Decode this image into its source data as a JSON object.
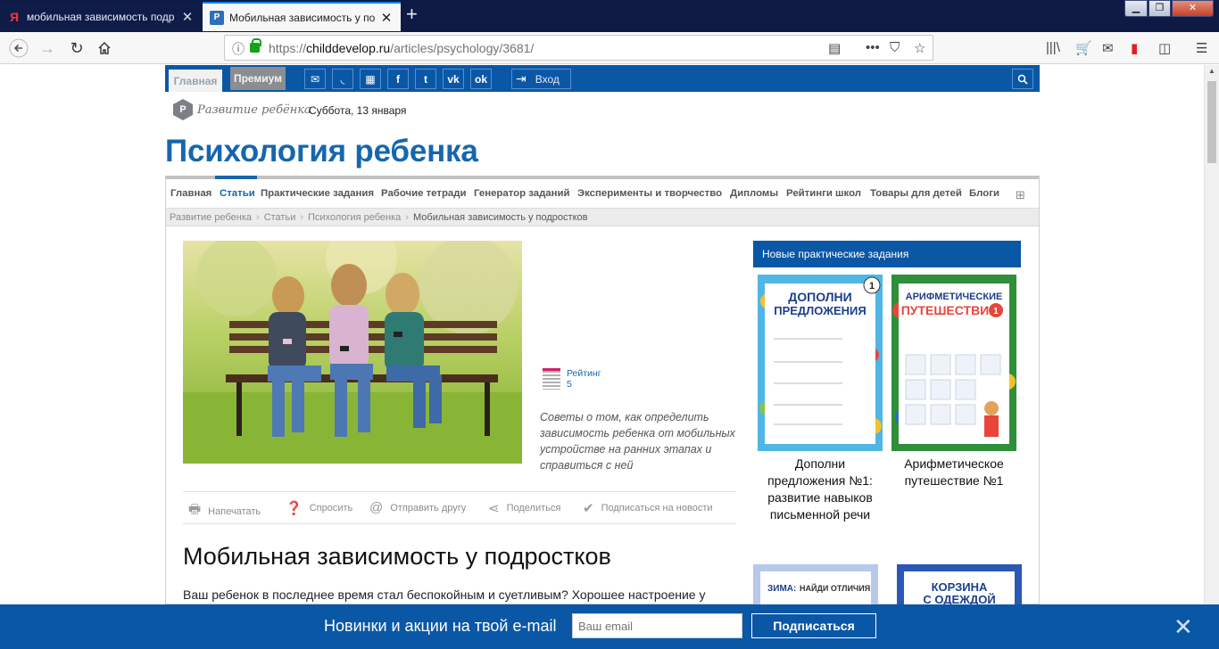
{
  "browser": {
    "tabs": [
      {
        "title": "мобильная зависимость подр",
        "active": false
      },
      {
        "title": "Мобильная зависимость у по",
        "active": true
      }
    ],
    "url_prefix": "https://",
    "url_host": "childdevelop.ru",
    "url_path": "/articles/psychology/3681/"
  },
  "topbar": {
    "home_label": "Главная",
    "premium_label": "Премиум",
    "login_label": "Вход",
    "social_icons": [
      "mail-icon",
      "rss-icon",
      "qr-icon",
      "facebook-icon",
      "twitter-icon",
      "vk-icon",
      "odnoklassniki-icon"
    ]
  },
  "site": {
    "logo_text": "Развитие ребёнка",
    "date": "Суббота, 13 января",
    "section_title": "Психология ребенка"
  },
  "menu": {
    "items": [
      "Главная",
      "Статьи",
      "Практические задания",
      "Рабочие тетради",
      "Генератор заданий",
      "Эксперименты и творчество",
      "Дипломы",
      "Рейтинги школ",
      "Товары для детей",
      "Блоги"
    ],
    "active": "Статьи"
  },
  "breadcrumbs": [
    "Развитие ребенка",
    "Статьи",
    "Психология ребенка",
    "Мобильная зависимость у подростков"
  ],
  "article": {
    "rating_label": "Рейтинг",
    "rating_value": "5",
    "excerpt": "Советы о том, как определить зависимость ребенка от мобильных устройстве на ранних этапах и справиться с ней",
    "actions": [
      "Напечатать",
      "Спросить",
      "Отправить другу",
      "Поделиться",
      "Подписаться на новости"
    ],
    "title": "Мобильная зависимость у подростков",
    "lead": "Ваш ребенок в последнее время стал беспокойным и суетливым? Хорошее настроение у"
  },
  "sidebar": {
    "heading": "Новые практические задания",
    "tasks": [
      {
        "title": "Дополни предложения №1: развитие навыков письменной речи",
        "cover_title_1": "ДОПОЛНИ",
        "cover_title_2": "ПРЕДЛОЖЕНИЯ",
        "cover_number": "1"
      },
      {
        "title": "Арифметическое путешествие №1",
        "cover_title_1": "АРИФМЕТИЧЕСКИЕ",
        "cover_title_2": "ПУТЕШЕСТВИЯ",
        "cover_number": "1"
      }
    ],
    "more": [
      {
        "cover_title_1": "ЗИМА:",
        "cover_title_2": "НАЙДИ ОТЛИЧИЯ"
      },
      {
        "cover_title_1": "КОРЗИНА",
        "cover_title_2": "С ОДЕЖДОЙ"
      }
    ]
  },
  "promo": {
    "text": "Новинки и акции на твой e-mail",
    "email_placeholder": "Ваш email",
    "subscribe_label": "Подписаться"
  },
  "colors": {
    "brand_blue": "#0a57a6",
    "title_blue": "#1566b0"
  }
}
